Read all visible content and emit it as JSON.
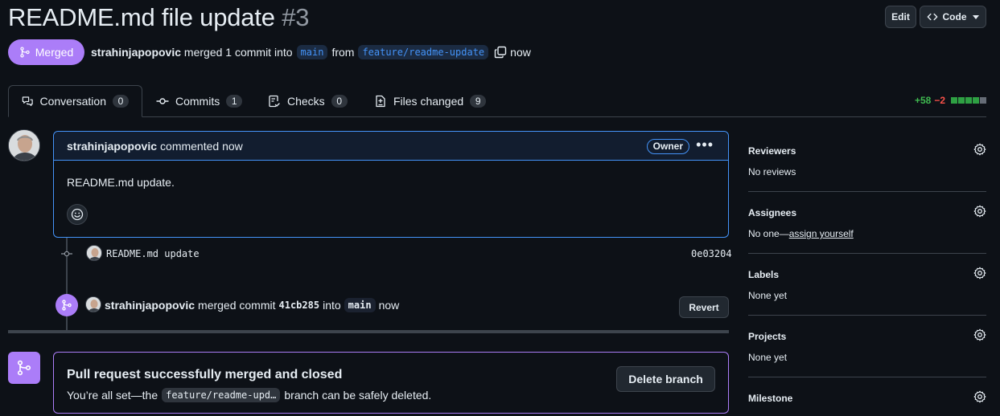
{
  "header": {
    "title": "README.md file update",
    "number": "#3",
    "edit_label": "Edit",
    "code_label": "Code"
  },
  "meta": {
    "state_label": "Merged",
    "author": "strahinjapopovic",
    "action_text": "merged 1 commit into",
    "base_branch": "main",
    "from_text": "from",
    "head_branch": "feature/readme-update",
    "time": "now"
  },
  "tabs": [
    {
      "label": "Conversation",
      "count": "0",
      "icon": "comment-discussion-icon"
    },
    {
      "label": "Commits",
      "count": "1",
      "icon": "git-commit-icon"
    },
    {
      "label": "Checks",
      "count": "0",
      "icon": "checklist-icon"
    },
    {
      "label": "Files changed",
      "count": "9",
      "icon": "file-diff-icon"
    }
  ],
  "diffstat": {
    "additions": "+58",
    "deletions": "−2",
    "colors": [
      "#2ea043",
      "#2ea043",
      "#2ea043",
      "#2ea043",
      "#656c76"
    ]
  },
  "comment": {
    "author": "strahinjapopovic",
    "action": "commented now",
    "role_badge": "Owner",
    "body": "README.md update."
  },
  "commit": {
    "message": "README.md update",
    "sha": "0e03204"
  },
  "merge_event": {
    "author": "strahinjapopovic",
    "action": "merged commit",
    "sha": "41cb285",
    "into": "into",
    "branch": "main",
    "time": "now",
    "revert_label": "Revert"
  },
  "merge_box": {
    "title": "Pull request successfully merged and closed",
    "text_before": "You’re all set—the",
    "branch_chip": "feature/readme-upd…",
    "text_after": "branch can be safely deleted.",
    "delete_label": "Delete branch"
  },
  "sidebar": {
    "reviewers": {
      "heading": "Reviewers",
      "value": "No reviews"
    },
    "assignees": {
      "heading": "Assignees",
      "value_prefix": "No one—",
      "value_link": "assign yourself"
    },
    "labels": {
      "heading": "Labels",
      "value": "None yet"
    },
    "projects": {
      "heading": "Projects",
      "value": "None yet"
    },
    "milestone": {
      "heading": "Milestone"
    }
  },
  "colors": {
    "merged_purple": "#ab7df8",
    "accent_blue": "#4493f8",
    "background": "#0d1117"
  }
}
